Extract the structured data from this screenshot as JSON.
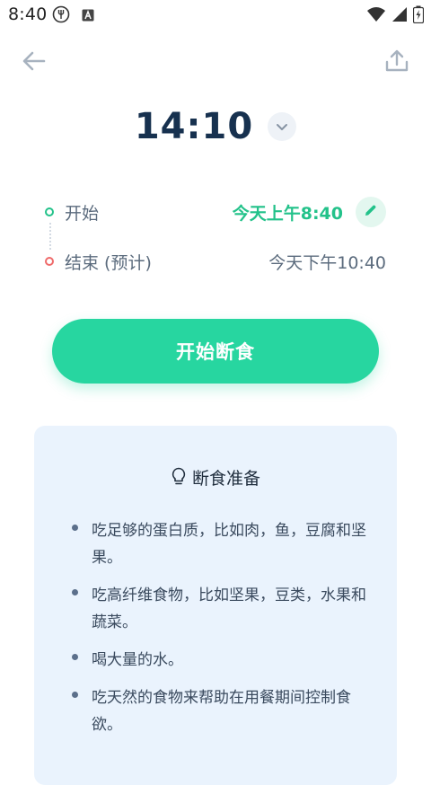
{
  "status_bar": {
    "time": "8:40"
  },
  "duration": {
    "value": "14:10"
  },
  "schedule": {
    "start_label": "开始",
    "start_value": "今天上午8:40",
    "end_label": "结束 (预计)",
    "end_value": "今天下午10:40"
  },
  "actions": {
    "start_fast_label": "开始断食"
  },
  "tips": {
    "title": "断食准备",
    "items": [
      "吃足够的蛋白质，比如肉，鱼，豆腐和坚果。",
      "吃高纤维食物，比如坚果，豆类，水果和蔬菜。",
      "喝大量的水。",
      "吃天然的食物来帮助在用餐期间控制食欲。"
    ]
  },
  "colors": {
    "accent": "#27d6a0",
    "start_dot": "#23c28a",
    "end_dot": "#ef6b6b",
    "card_bg": "#eaf3fd"
  }
}
